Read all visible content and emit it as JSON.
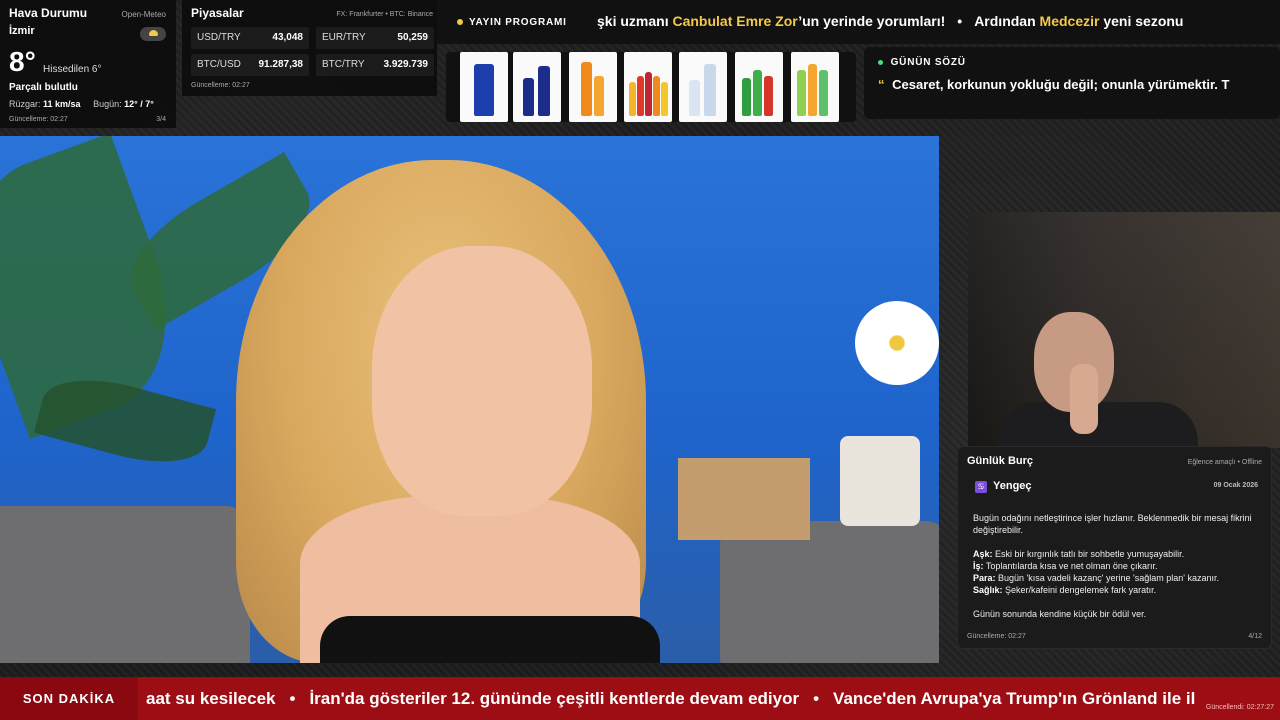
{
  "weather": {
    "title": "Hava Durumu",
    "source": "Open-Meteo",
    "city": "İzmir",
    "temp": "8°",
    "feels_like": "Hissedilen 6°",
    "condition": "Parçalı bulutlu",
    "wind_label": "Rüzgar:",
    "wind_value": "11 km/sa",
    "today_label": "Bugün:",
    "today_value": "12° / 7°",
    "updated": "Güncelleme: 02:27",
    "page": "3/4",
    "icon": "partly-cloudy-icon"
  },
  "markets": {
    "title": "Piyasalar",
    "source": "FX: Frankfurter • BTC: Binance",
    "items": [
      {
        "label": "USD/TRY",
        "value": "43,048"
      },
      {
        "label": "EUR/TRY",
        "value": "50,259"
      },
      {
        "label": "BTC/USD",
        "value": "91.287,38"
      },
      {
        "label": "BTC/TRY",
        "value": "3.929.739"
      }
    ],
    "updated": "Güncelleme: 02:27"
  },
  "top_ticker": {
    "label": "YAYIN PROGRAMI",
    "part1": "şki uzmanı ",
    "highlight1": "Canbulat Emre Zor",
    "part2": "’un yerinde yorumları!",
    "separator": "•",
    "part3": "Ardından ",
    "highlight2": "Medcezir",
    "part4": " yeni sezonu"
  },
  "quote": {
    "head": "GÜNÜN SÖZÜ",
    "mark": "“",
    "text": "Cesaret, korkunun yokluğu değil; onunla yürümektir. T"
  },
  "horoscope": {
    "title": "Günlük Burç",
    "meta": "Eğlence amaçlı • Offline",
    "sign": "Yengeç",
    "sign_icon": "♋",
    "date": "09 Ocak 2026",
    "intro": "Bugün odağını netleştirince işler hızlanır. Beklenmedik bir mesaj fikrini değiştirebilir.",
    "love_label": "Aşk:",
    "love": " Eski bir kırgınlık tatlı bir sohbetle yumuşayabilir.",
    "work_label": "İş:",
    "work": " Toplantılarda kısa ve net olman öne çıkarır.",
    "money_label": "Para:",
    "money": " Bugün 'kısa vadeli kazanç' yerine 'sağlam plan' kazanır.",
    "health_label": "Sağlık:",
    "health": " Şeker/kafeini dengelemek fark yaratır.",
    "closing": "Günün sonunda kendine küçük bir ödül ver.",
    "updated": "Güncelleme: 02:27",
    "page": "4/12"
  },
  "breaking": {
    "label": "SON DAKİKA",
    "item1": "aat su kesilecek",
    "item2": "İran'da gösteriler 12. gününde çeşitli kentlerde devam ediyor",
    "item3": "Vance'den Avrupa'ya Trump'ın Grönland ile il",
    "separator": "•",
    "updated": "Güncellendi: 02:27:27"
  },
  "colors": {
    "accent": "#f3c94a",
    "breaking_bg": "#9c0d14",
    "quote_dot": "#4ade80"
  }
}
